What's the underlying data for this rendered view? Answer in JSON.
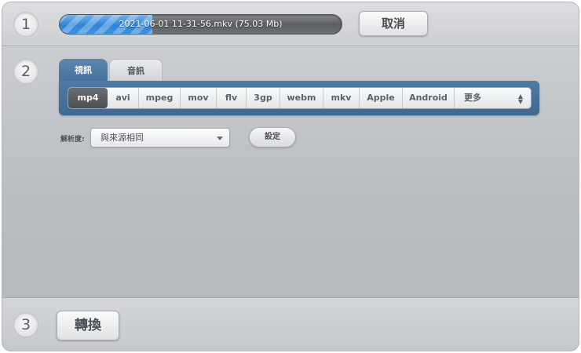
{
  "steps": [
    "1",
    "2",
    "3"
  ],
  "progress": {
    "text": "2021-06-01 11-31-56.mkv (75.03 Mb)",
    "fraction": 0.33,
    "fill_color": "#2f83d6"
  },
  "cancel_label": "取消",
  "tabs": [
    {
      "label": "視訊",
      "active": true
    },
    {
      "label": "音訊",
      "active": false
    }
  ],
  "formats": {
    "items": [
      "mp4",
      "avi",
      "mpeg",
      "mov",
      "flv",
      "3gp",
      "webm",
      "mkv",
      "Apple",
      "Android"
    ],
    "selected": "mp4",
    "more_label": "更多"
  },
  "resolution": {
    "label": "解析度:",
    "value": "與來源相同"
  },
  "settings_label": "設定",
  "convert_label": "轉換",
  "colors": {
    "accent": "#43719b",
    "progress": "#2f83d6"
  }
}
